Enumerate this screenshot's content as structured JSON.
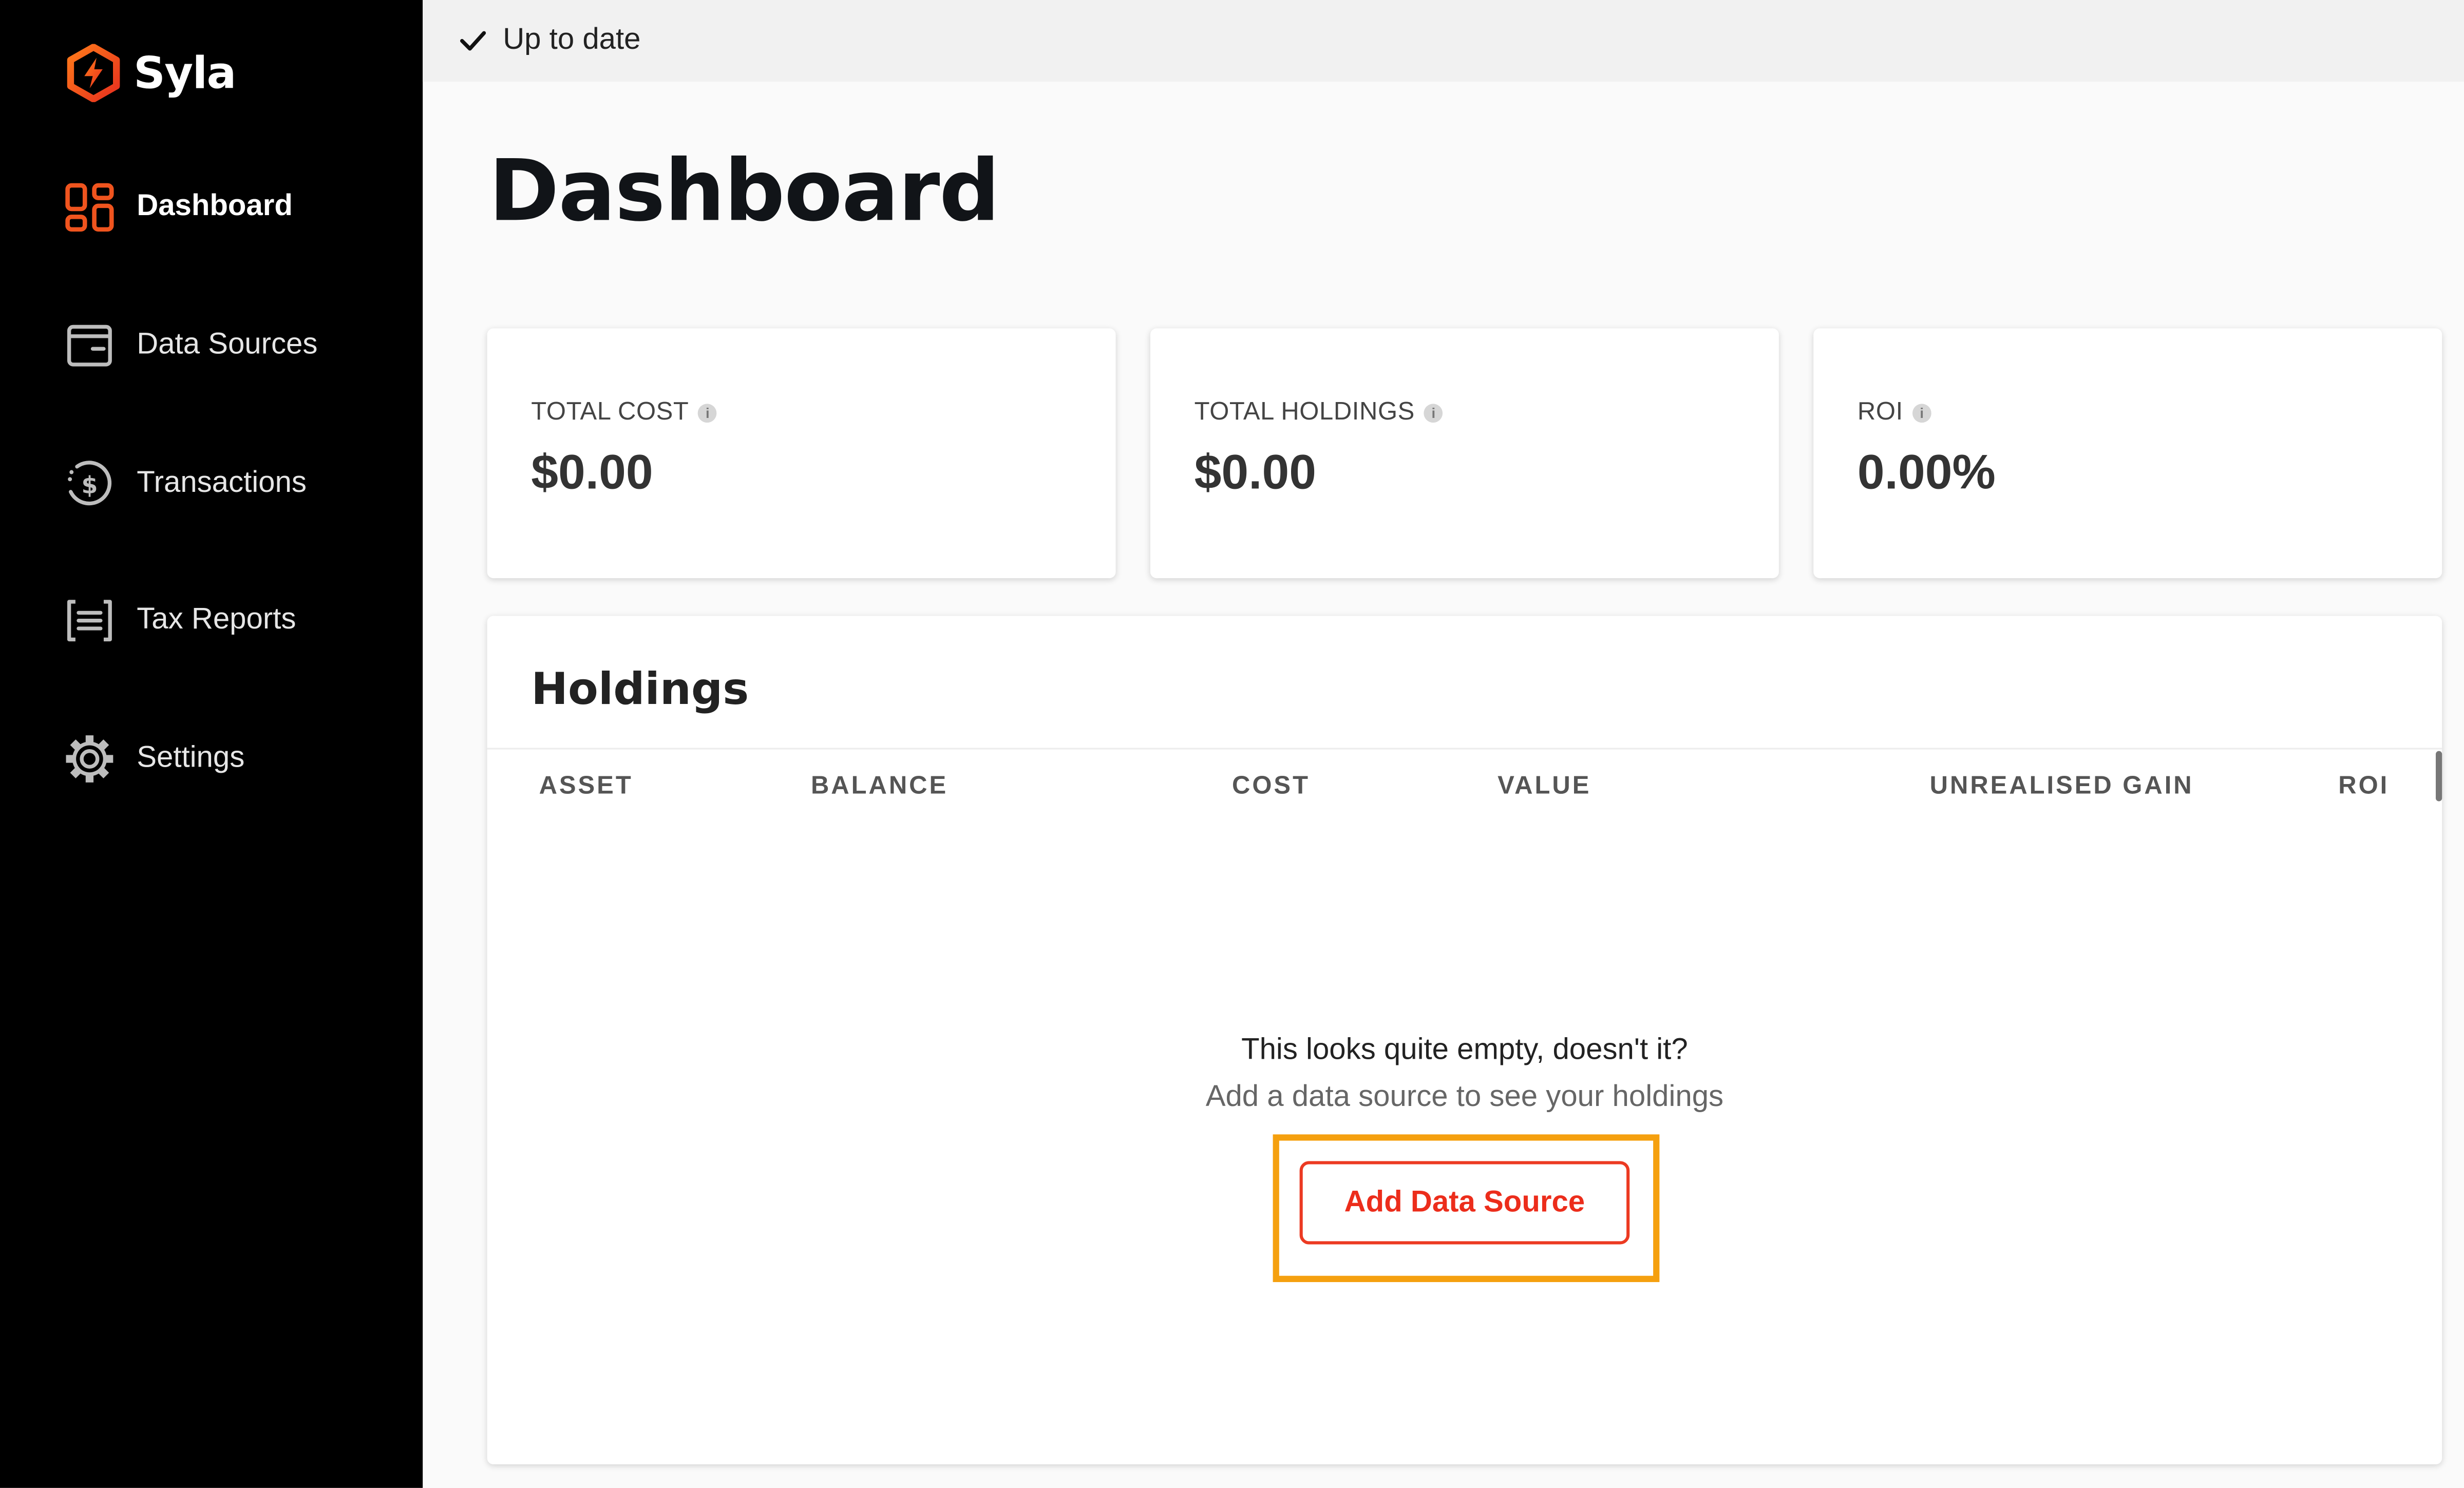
{
  "app": {
    "name": "Syla"
  },
  "sidebar": {
    "items": [
      {
        "label": "Dashboard",
        "icon": "dashboard-grid-icon",
        "active": true
      },
      {
        "label": "Data Sources",
        "icon": "wallet-icon",
        "active": false
      },
      {
        "label": "Transactions",
        "icon": "dollar-circle-icon",
        "active": false
      },
      {
        "label": "Tax Reports",
        "icon": "report-list-icon",
        "active": false
      },
      {
        "label": "Settings",
        "icon": "gear-icon",
        "active": false
      }
    ]
  },
  "topbar": {
    "status": "Up to date",
    "icon": "checkmark-icon"
  },
  "page": {
    "title": "Dashboard"
  },
  "stats": [
    {
      "label": "TOTAL COST",
      "value": "$0.00"
    },
    {
      "label": "TOTAL HOLDINGS",
      "value": "$0.00"
    },
    {
      "label": "ROI",
      "value": "0.00%"
    }
  ],
  "holdings": {
    "title": "Holdings",
    "columns": [
      "ASSET",
      "BALANCE",
      "COST",
      "VALUE",
      "UNREALISED GAIN",
      "ROI"
    ],
    "empty_title": "This looks quite empty, doesn't it?",
    "empty_subtitle": "Add a data source to see your holdings",
    "add_button": "Add Data Source"
  },
  "colors": {
    "brand": "#f0541e",
    "sidebar_bg": "#000000",
    "button_accent": "#ec2d1b",
    "highlight": "#f5a00f"
  }
}
